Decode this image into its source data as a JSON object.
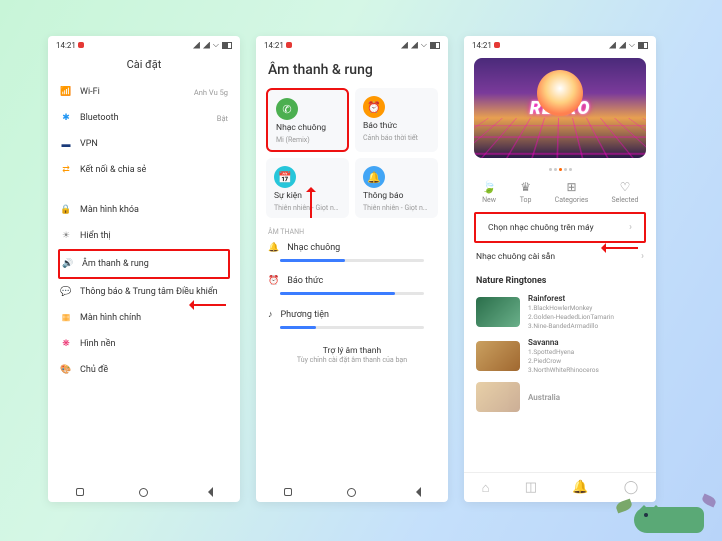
{
  "status": {
    "time": "14:21"
  },
  "screen1": {
    "title": "Cài đặt",
    "items": [
      {
        "icon": "📶",
        "cls": "c-blue",
        "label": "Wi-Fi",
        "value": "Anh Vu 5g"
      },
      {
        "icon": "✱",
        "cls": "c-blue",
        "label": "Bluetooth",
        "value": "Bật"
      },
      {
        "icon": "▬",
        "cls": "c-navy",
        "label": "VPN",
        "value": ""
      },
      {
        "icon": "⇄",
        "cls": "c-orange",
        "label": "Kết nối & chia sẻ",
        "value": ""
      }
    ],
    "items2": [
      {
        "icon": "🔒",
        "cls": "c-orange",
        "label": "Màn hình khóa"
      },
      {
        "icon": "☀",
        "cls": "c-gray",
        "label": "Hiển thị"
      },
      {
        "icon": "🔊",
        "cls": "c-green",
        "label": "Âm thanh & rung",
        "hl": true
      },
      {
        "icon": "💬",
        "cls": "c-blue",
        "label": "Thông báo & Trung tâm Điều khiển"
      },
      {
        "icon": "▦",
        "cls": "c-orange",
        "label": "Màn hình chính"
      },
      {
        "icon": "❋",
        "cls": "c-pink",
        "label": "Hình nền"
      },
      {
        "icon": "🎨",
        "cls": "c-gray",
        "label": "Chủ đề"
      }
    ]
  },
  "screen2": {
    "title": "Âm thanh & rung",
    "cards": [
      {
        "bg": "bg-green",
        "glyph": "✆",
        "title": "Nhạc chuông",
        "sub": "Mi (Remix)",
        "hl": true
      },
      {
        "bg": "bg-orange",
        "glyph": "⏰",
        "title": "Báo thức",
        "sub": "Cảnh báo thời tiết"
      },
      {
        "bg": "bg-teal",
        "glyph": "📅",
        "title": "Sự kiện",
        "sub": "Thiên nhiên - Giọt n…"
      },
      {
        "bg": "bg-blue",
        "glyph": "🔔",
        "title": "Thông báo",
        "sub": "Thiên nhiên - Giọt n…"
      }
    ],
    "section": "Âm thanh",
    "sliders": [
      {
        "icon": "🔔",
        "label": "Nhạc chuông",
        "pct": 45
      },
      {
        "icon": "⏰",
        "label": "Báo thức",
        "pct": 80
      },
      {
        "icon": "♪",
        "label": "Phương tiện",
        "pct": 25
      }
    ],
    "footer_a": "Trợ lý âm thanh",
    "footer_b": "Tùy chỉnh cài đặt âm thanh của bạn"
  },
  "screen3": {
    "banner": "RETRO",
    "tabs": [
      {
        "glyph": "🍃",
        "label": "New"
      },
      {
        "glyph": "♛",
        "label": "Top"
      },
      {
        "glyph": "⊞",
        "label": "Categories"
      },
      {
        "glyph": "♡",
        "label": "Selected"
      }
    ],
    "opt1": "Chọn nhạc chuông trên máy",
    "opt2": "Nhạc chuông cài sẵn",
    "section": "Nature Ringtones",
    "ring1": {
      "name": "Rainforest",
      "l1": "1.BlackHowlerMonkey",
      "l2": "2.Golden-HeadedLionTamarin",
      "l3": "3.Nine-BandedArmadillo"
    },
    "ring2": {
      "name": "Savanna",
      "l1": "1.SpottedHyena",
      "l2": "2.PiedCrow",
      "l3": "3.NorthWhiteRhinoceros"
    },
    "ring3_name": "Australia"
  }
}
